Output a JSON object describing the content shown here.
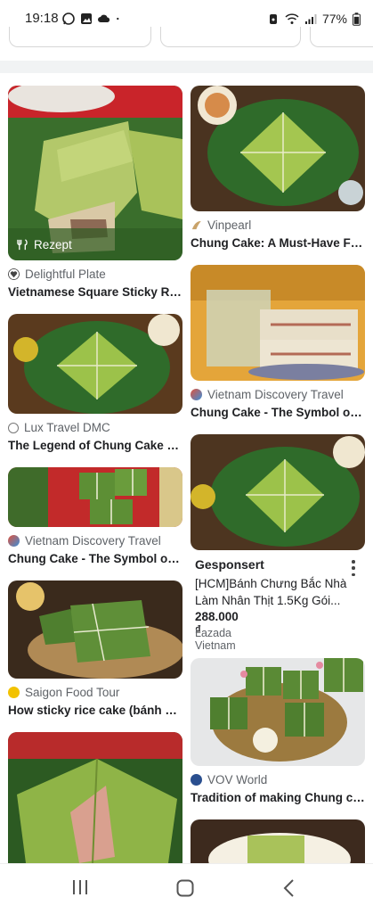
{
  "status_bar": {
    "time": "19:18",
    "battery": "77%"
  },
  "results": {
    "left": [
      {
        "recipe_badge": "Rezept",
        "source": "Delightful Plate",
        "title": "Vietnamese Square Sticky Ri...",
        "favicon_color": "#444444"
      },
      {
        "source": "Lux Travel DMC",
        "title": "The Legend of Chung Cake – ...",
        "favicon_color": "#777777"
      },
      {
        "source": "Vietnam Discovery Travel",
        "title": "Chung Cake - The Symbol of ...",
        "favicon_color": "#e0533d"
      },
      {
        "source": "Saigon Food Tour",
        "title": "How sticky rice cake (bánh ch...",
        "favicon_color": "#f2c200"
      }
    ],
    "right": [
      {
        "source": "Vinpearl",
        "title": "Chung Cake: A Must-Have Fo...",
        "favicon_color": "#c9a36a"
      },
      {
        "source": "Vietnam Discovery Travel",
        "title": "Chung Cake - The Symbol of ...",
        "favicon_color": "#e0533d"
      },
      {
        "source": "VOV World",
        "title": "Tradition of making Chung ca...",
        "favicon_color": "#2a4f8f"
      }
    ],
    "sponsored": {
      "label": "Gesponsert",
      "title": "[HCM]Bánh Chưng Bắc Nhà Làm Nhân Thịt 1.5Kg Gói...",
      "price": "288.000 ₫",
      "seller": "Lazada Vietnam"
    }
  },
  "colors": {
    "leaf_green": "#2f6b2a",
    "cake_green": "#9cc24a",
    "wood": "#8a5a2b"
  },
  "icons": [
    "whatsapp-icon",
    "gallery-icon",
    "cloud-icon",
    "alarm-icon",
    "wifi-icon",
    "signal-icon",
    "battery-icon",
    "cutlery-icon",
    "more-vert-icon",
    "recents-icon",
    "home-icon",
    "back-icon"
  ]
}
